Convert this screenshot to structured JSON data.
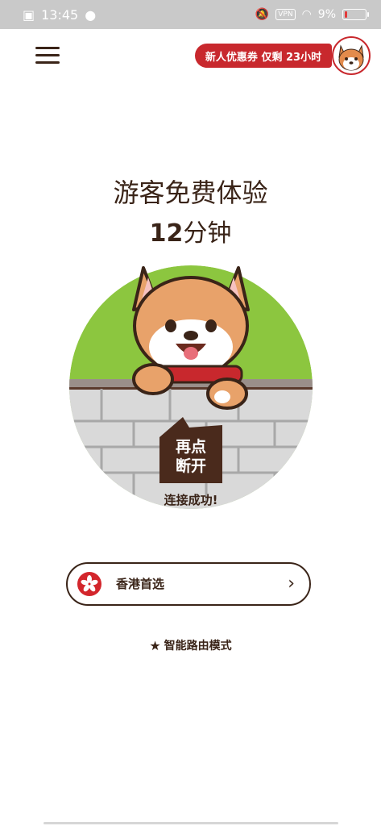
{
  "status_bar": {
    "time": "13:45",
    "vpn": "VPN",
    "battery": "9%"
  },
  "header": {
    "coupon_text": "新人优惠券 仅剩 23小时"
  },
  "main": {
    "title": "游客免费体验",
    "trial_minutes": "12",
    "trial_unit": "分钟",
    "button_text": "再点\n断开",
    "status_text": "连接成功!"
  },
  "server": {
    "name": "香港首选",
    "chevron": "›"
  },
  "mode": {
    "label": "智能路由模式"
  },
  "colors": {
    "brand_red": "#c8282d",
    "brown": "#3a2418",
    "grass_green": "#8cc63f",
    "wall_gray": "#d9d9d9"
  }
}
